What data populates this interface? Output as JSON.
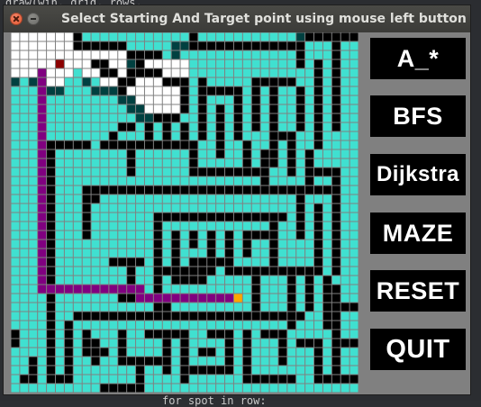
{
  "window": {
    "title": "Select Starting And Target point using mouse left button"
  },
  "buttons": [
    {
      "label": "A_*",
      "name": "astar-button"
    },
    {
      "label": "BFS",
      "name": "bfs-button"
    },
    {
      "label": "Dijkstra",
      "name": "dijkstra-button"
    },
    {
      "label": "MAZE",
      "name": "maze-button"
    },
    {
      "label": "RESET",
      "name": "reset-button"
    },
    {
      "label": "QUIT",
      "name": "quit-button"
    }
  ],
  "background_code": {
    "top_line": "draw(win, grid, rows, ",
    "bottom_line": "for spot in row:"
  },
  "grid": {
    "rows": 40,
    "cols": 39,
    "colors": {
      "open": "#40e0d0",
      "barrier": "#000000",
      "closed": "#ffffff",
      "frontier": "#004040",
      "path": "#800080",
      "start": "#8b0000",
      "target": "#ffa500",
      "grid_line": "#808080",
      "window_bg": "#808080",
      "button_bg": "#000000",
      "button_text": "#ffffff"
    },
    "start": [
      5,
      3
    ],
    "target": [
      25,
      29
    ],
    "path": [
      [
        3,
        4
      ],
      [
        3,
        5
      ],
      [
        3,
        6
      ],
      [
        3,
        7
      ],
      [
        3,
        8
      ],
      [
        3,
        9
      ],
      [
        3,
        10
      ],
      [
        3,
        11
      ],
      [
        3,
        12
      ],
      [
        3,
        13
      ],
      [
        3,
        14
      ],
      [
        3,
        15
      ],
      [
        3,
        16
      ],
      [
        3,
        17
      ],
      [
        3,
        18
      ],
      [
        3,
        19
      ],
      [
        3,
        20
      ],
      [
        3,
        21
      ],
      [
        3,
        22
      ],
      [
        3,
        23
      ],
      [
        3,
        24
      ],
      [
        3,
        25
      ],
      [
        3,
        26
      ],
      [
        3,
        27
      ],
      [
        3,
        28
      ],
      [
        4,
        28
      ],
      [
        5,
        28
      ],
      [
        6,
        28
      ],
      [
        7,
        28
      ],
      [
        8,
        28
      ],
      [
        9,
        28
      ],
      [
        10,
        28
      ],
      [
        11,
        28
      ],
      [
        12,
        28
      ],
      [
        13,
        28
      ],
      [
        14,
        28
      ],
      [
        14,
        29
      ],
      [
        15,
        29
      ],
      [
        16,
        29
      ],
      [
        17,
        29
      ],
      [
        18,
        29
      ],
      [
        19,
        29
      ],
      [
        20,
        29
      ],
      [
        21,
        29
      ],
      [
        22,
        29
      ],
      [
        23,
        29
      ],
      [
        24,
        29
      ]
    ],
    "barriers": [
      [
        7,
        0,
        7,
        1
      ],
      [
        8,
        1,
        12,
        1
      ],
      [
        13,
        2,
        16,
        2
      ],
      [
        20,
        0,
        20,
        1
      ],
      [
        21,
        1,
        31,
        1
      ],
      [
        32,
        1,
        32,
        3
      ],
      [
        33,
        0,
        38,
        0
      ],
      [
        36,
        1,
        36,
        10
      ],
      [
        14,
        3,
        14,
        4
      ],
      [
        13,
        4,
        13,
        5
      ],
      [
        15,
        4,
        16,
        4
      ],
      [
        9,
        3,
        10,
        3
      ],
      [
        10,
        4,
        11,
        4
      ],
      [
        12,
        5,
        12,
        6
      ],
      [
        17,
        5,
        19,
        5
      ],
      [
        19,
        6,
        19,
        8
      ],
      [
        21,
        5,
        21,
        11
      ],
      [
        22,
        6,
        24,
        6
      ],
      [
        25,
        6,
        25,
        11
      ],
      [
        27,
        5,
        27,
        10
      ],
      [
        28,
        5,
        31,
        5
      ],
      [
        29,
        6,
        29,
        14
      ],
      [
        34,
        3,
        34,
        12
      ],
      [
        32,
        6,
        32,
        10
      ],
      [
        23,
        8,
        23,
        13
      ],
      [
        16,
        9,
        18,
        9
      ],
      [
        15,
        10,
        15,
        11
      ],
      [
        17,
        10,
        17,
        11
      ],
      [
        19,
        10,
        19,
        12
      ],
      [
        11,
        11,
        11,
        12
      ],
      [
        12,
        10,
        13,
        10
      ],
      [
        4,
        12,
        8,
        12
      ],
      [
        4,
        13,
        4,
        38
      ],
      [
        10,
        12,
        20,
        12
      ],
      [
        13,
        13,
        13,
        15
      ],
      [
        20,
        13,
        20,
        15
      ],
      [
        21,
        15,
        27,
        15
      ],
      [
        28,
        13,
        28,
        16
      ],
      [
        30,
        11,
        31,
        11
      ],
      [
        31,
        12,
        31,
        15
      ],
      [
        26,
        12,
        26,
        14
      ],
      [
        33,
        13,
        33,
        17
      ],
      [
        30,
        17,
        32,
        17
      ],
      [
        34,
        15,
        36,
        15
      ],
      [
        36,
        16,
        36,
        26
      ],
      [
        8,
        17,
        35,
        17
      ],
      [
        8,
        18,
        8,
        22
      ],
      [
        9,
        18,
        9,
        18
      ],
      [
        32,
        18,
        32,
        22
      ],
      [
        34,
        19,
        34,
        26
      ],
      [
        35,
        27,
        35,
        32
      ],
      [
        16,
        20,
        30,
        20
      ],
      [
        16,
        21,
        16,
        30
      ],
      [
        29,
        21,
        29,
        26
      ],
      [
        26,
        22,
        28,
        22
      ],
      [
        26,
        23,
        26,
        24
      ],
      [
        18,
        22,
        18,
        26
      ],
      [
        20,
        22,
        20,
        23
      ],
      [
        22,
        22,
        22,
        26
      ],
      [
        24,
        22,
        24,
        26
      ],
      [
        20,
        25,
        23,
        25
      ],
      [
        17,
        26,
        21,
        26
      ],
      [
        11,
        25,
        14,
        25
      ],
      [
        13,
        26,
        13,
        28
      ],
      [
        25,
        26,
        28,
        26
      ],
      [
        27,
        27,
        27,
        30
      ],
      [
        30,
        26,
        33,
        26
      ],
      [
        33,
        27,
        33,
        30
      ],
      [
        31,
        27,
        31,
        32
      ],
      [
        18,
        27,
        21,
        27
      ],
      [
        17,
        29,
        17,
        30
      ],
      [
        12,
        29,
        13,
        29
      ],
      [
        7,
        31,
        32,
        31
      ],
      [
        6,
        32,
        6,
        38
      ],
      [
        5,
        38,
        5,
        38
      ],
      [
        8,
        33,
        8,
        35
      ],
      [
        9,
        34,
        9,
        36
      ],
      [
        10,
        35,
        10,
        35
      ],
      [
        12,
        33,
        12,
        36
      ],
      [
        13,
        36,
        16,
        36
      ],
      [
        15,
        33,
        18,
        33
      ],
      [
        17,
        34,
        17,
        37
      ],
      [
        19,
        33,
        19,
        38
      ],
      [
        20,
        37,
        24,
        37
      ],
      [
        22,
        33,
        24,
        33
      ],
      [
        24,
        34,
        24,
        36
      ],
      [
        21,
        35,
        22,
        35
      ],
      [
        26,
        33,
        26,
        38
      ],
      [
        27,
        38,
        31,
        38
      ],
      [
        28,
        33,
        30,
        33
      ],
      [
        30,
        34,
        30,
        36
      ],
      [
        32,
        34,
        34,
        34
      ],
      [
        34,
        35,
        34,
        38
      ],
      [
        36,
        28,
        36,
        38
      ],
      [
        37,
        30,
        38,
        30
      ],
      [
        35,
        38,
        38,
        38
      ],
      [
        14,
        37,
        14,
        39
      ],
      [
        10,
        39,
        13,
        39
      ],
      [
        37,
        34,
        38,
        34
      ],
      [
        2,
        36,
        2,
        37
      ],
      [
        1,
        38,
        2,
        38
      ],
      [
        0,
        33,
        0,
        34
      ]
    ],
    "closed": [
      [
        0,
        0,
        6,
        2
      ],
      [
        7,
        2,
        12,
        2
      ],
      [
        1,
        3,
        8,
        3
      ],
      [
        0,
        3,
        0,
        3
      ],
      [
        9,
        2,
        12,
        3
      ],
      [
        11,
        3,
        12,
        3
      ],
      [
        11,
        4,
        12,
        4
      ],
      [
        0,
        4,
        2,
        4
      ],
      [
        4,
        4,
        6,
        4
      ],
      [
        12,
        3,
        13,
        3
      ],
      [
        15,
        3,
        19,
        3
      ],
      [
        17,
        4,
        19,
        4
      ],
      [
        14,
        5,
        16,
        5
      ],
      [
        13,
        6,
        18,
        6
      ],
      [
        14,
        7,
        18,
        7
      ],
      [
        15,
        8,
        18,
        8
      ],
      [
        16,
        9,
        16,
        9
      ],
      [
        8,
        4,
        9,
        4
      ],
      [
        4,
        5,
        5,
        5
      ],
      [
        10,
        5,
        11,
        5
      ]
    ],
    "frontier": [
      [
        20,
        0,
        20,
        0
      ],
      [
        18,
        1,
        19,
        1
      ],
      [
        0,
        5,
        0,
        5
      ],
      [
        2,
        5,
        3,
        5
      ],
      [
        4,
        6,
        5,
        6
      ],
      [
        9,
        6,
        10,
        6
      ],
      [
        11,
        6,
        12,
        6
      ],
      [
        12,
        7,
        13,
        7
      ],
      [
        13,
        8,
        14,
        8
      ],
      [
        14,
        9,
        14,
        9
      ],
      [
        15,
        9,
        15,
        9
      ],
      [
        18,
        2,
        18,
        2
      ],
      [
        14,
        2,
        14,
        2
      ],
      [
        13,
        3,
        13,
        3
      ],
      [
        32,
        0,
        32,
        0
      ],
      [
        8,
        5,
        8,
        5
      ]
    ]
  }
}
